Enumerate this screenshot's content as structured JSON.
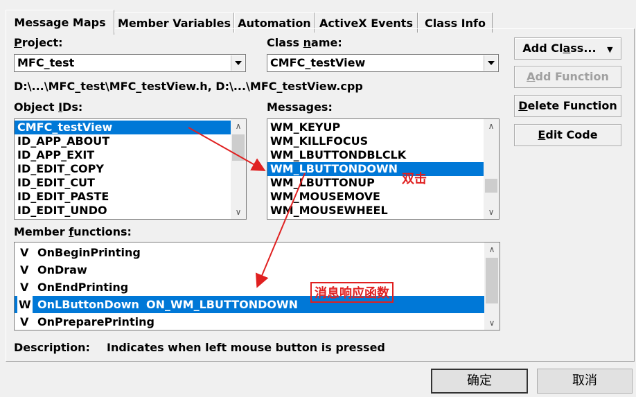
{
  "tabs": [
    "Message Maps",
    "Member Variables",
    "Automation",
    "ActiveX Events",
    "Class Info"
  ],
  "project": {
    "label_prefix": "",
    "label_ul": "P",
    "label_rest": "roject:",
    "value": "MFC_test"
  },
  "class_name": {
    "label_prefix": "Class ",
    "label_ul": "n",
    "label_rest": "ame:",
    "value": "CMFC_testView"
  },
  "file_path": "D:\\...\\MFC_test\\MFC_testView.h, D:\\...\\MFC_testView.cpp",
  "object_ids": {
    "label_prefix": "Object ",
    "label_ul": "I",
    "label_rest": "Ds:",
    "items": [
      "CMFC_testView",
      "ID_APP_ABOUT",
      "ID_APP_EXIT",
      "ID_EDIT_COPY",
      "ID_EDIT_CUT",
      "ID_EDIT_PASTE",
      "ID_EDIT_UNDO"
    ],
    "selected_index": 0
  },
  "messages": {
    "label": "Messages:",
    "items": [
      "WM_KEYUP",
      "WM_KILLFOCUS",
      "WM_LBUTTONDBLCLK",
      "WM_LBUTTONDOWN",
      "WM_LBUTTONUP",
      "WM_MOUSEMOVE",
      "WM_MOUSEWHEEL"
    ],
    "selected_index": 3
  },
  "member_functions": {
    "label_prefix": "Member ",
    "label_ul": "f",
    "label_rest": "unctions:",
    "items": [
      {
        "flag": "V",
        "name": "OnBeginPrinting",
        "msg": ""
      },
      {
        "flag": "V",
        "name": "OnDraw",
        "msg": ""
      },
      {
        "flag": "V",
        "name": "OnEndPrinting",
        "msg": ""
      },
      {
        "flag": "W",
        "name": "OnLButtonDown",
        "msg": "ON_WM_LBUTTONDOWN"
      },
      {
        "flag": "V",
        "name": "OnPreparePrinting",
        "msg": ""
      }
    ],
    "selected_index": 3
  },
  "description": {
    "label": "Description:",
    "text": "Indicates when left mouse button is pressed"
  },
  "buttons": {
    "add_class_pre": "Add Cl",
    "add_class_ul": "a",
    "add_class_post": "ss...",
    "add_function_ul": "A",
    "add_function_post": "dd Function",
    "delete_function_ul": "D",
    "delete_function_post": "elete Function",
    "edit_code_ul": "E",
    "edit_code_post": "dit Code"
  },
  "annotations": {
    "double_click": "双击",
    "handler": "消息响应函数"
  },
  "dialog_buttons": {
    "ok": "确定",
    "cancel": "取消"
  },
  "colors": {
    "selection": "#0078d7",
    "annotation": "#e02020"
  }
}
